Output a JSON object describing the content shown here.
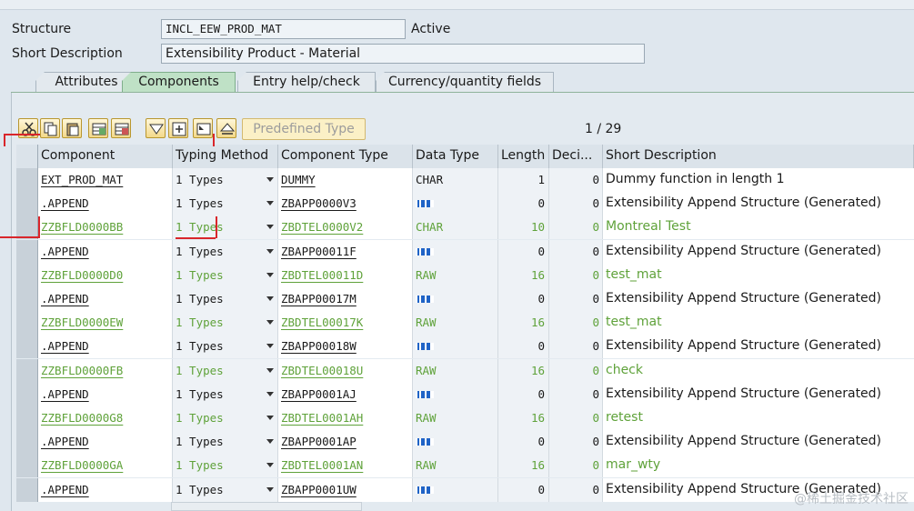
{
  "header": {
    "structure_label": "Structure",
    "structure_value": "INCL_EEW_PROD_MAT",
    "status": "Active",
    "short_desc_label": "Short Description",
    "short_desc_value": "Extensibility Product - Material"
  },
  "tabs": [
    {
      "label": "Attributes",
      "active": false
    },
    {
      "label": "Components",
      "active": true
    },
    {
      "label": "Entry help/check",
      "active": false
    },
    {
      "label": "Currency/quantity fields",
      "active": false
    }
  ],
  "toolbar": {
    "icons": [
      "cut-icon",
      "copy-icon",
      "paste-icon",
      "insert-row-icon",
      "delete-row-icon",
      "filter-icon",
      "details-icon",
      "settings-icon",
      "collapse-icon"
    ],
    "predefined_type_label": "Predefined Type",
    "pager": "1  / 29"
  },
  "columns": {
    "component": "Component",
    "typing_method": "Typing Method",
    "component_type": "Component Type",
    "data_type": "Data Type",
    "length": "Length",
    "decimals": "Deci...",
    "short_description": "Short Description"
  },
  "rows": [
    {
      "component": "EXT_PROD_MAT",
      "typing": "1 Types",
      "ctype": "DUMMY",
      "dtype": "CHAR",
      "length": "1",
      "dec": "0",
      "desc": "Dummy function in length 1",
      "green": false,
      "struct": false
    },
    {
      "component": ".APPEND",
      "typing": "1 Types",
      "ctype": "ZBAPP0000V3",
      "dtype": "",
      "length": "0",
      "dec": "0",
      "desc": "Extensibility Append Structure (Generated)",
      "green": false,
      "struct": true
    },
    {
      "component": "ZZBFLD0000BB",
      "typing": "1 Types",
      "ctype": "ZBDTEL0000V2",
      "dtype": "CHAR",
      "length": "10",
      "dec": "0",
      "desc": "Montreal Test",
      "green": true,
      "struct": false
    },
    {
      "component": ".APPEND",
      "typing": "1 Types",
      "ctype": "ZBAPP00011F",
      "dtype": "",
      "length": "0",
      "dec": "0",
      "desc": "Extensibility Append Structure (Generated)",
      "green": false,
      "struct": true
    },
    {
      "component": "ZZBFLD0000D0",
      "typing": "1 Types",
      "ctype": "ZBDTEL00011D",
      "dtype": "RAW",
      "length": "16",
      "dec": "0",
      "desc": "test_mat",
      "green": true,
      "struct": false
    },
    {
      "component": ".APPEND",
      "typing": "1 Types",
      "ctype": "ZBAPP00017M",
      "dtype": "",
      "length": "0",
      "dec": "0",
      "desc": "Extensibility Append Structure (Generated)",
      "green": false,
      "struct": true
    },
    {
      "component": "ZZBFLD0000EW",
      "typing": "1 Types",
      "ctype": "ZBDTEL00017K",
      "dtype": "RAW",
      "length": "16",
      "dec": "0",
      "desc": "test_mat",
      "green": true,
      "struct": false
    },
    {
      "component": ".APPEND",
      "typing": "1 Types",
      "ctype": "ZBAPP00018W",
      "dtype": "",
      "length": "0",
      "dec": "0",
      "desc": "Extensibility Append Structure (Generated)",
      "green": false,
      "struct": true
    },
    {
      "component": "ZZBFLD0000FB",
      "typing": "1 Types",
      "ctype": "ZBDTEL00018U",
      "dtype": "RAW",
      "length": "16",
      "dec": "0",
      "desc": "check",
      "green": true,
      "struct": false
    },
    {
      "component": ".APPEND",
      "typing": "1 Types",
      "ctype": "ZBAPP0001AJ",
      "dtype": "",
      "length": "0",
      "dec": "0",
      "desc": "Extensibility Append Structure (Generated)",
      "green": false,
      "struct": true
    },
    {
      "component": "ZZBFLD0000G8",
      "typing": "1 Types",
      "ctype": "ZBDTEL0001AH",
      "dtype": "RAW",
      "length": "16",
      "dec": "0",
      "desc": "retest",
      "green": true,
      "struct": false
    },
    {
      "component": ".APPEND",
      "typing": "1 Types",
      "ctype": "ZBAPP0001AP",
      "dtype": "",
      "length": "0",
      "dec": "0",
      "desc": "Extensibility Append Structure (Generated)",
      "green": false,
      "struct": true
    },
    {
      "component": "ZZBFLD0000GA",
      "typing": "1 Types",
      "ctype": "ZBDTEL0001AN",
      "dtype": "RAW",
      "length": "16",
      "dec": "0",
      "desc": "mar_wty",
      "green": true,
      "struct": false
    },
    {
      "component": ".APPEND",
      "typing": "1 Types",
      "ctype": "ZBAPP0001UW",
      "dtype": "",
      "length": "0",
      "dec": "0",
      "desc": "Extensibility Append Structure (Generated)",
      "green": false,
      "struct": true
    }
  ],
  "watermark": "@稀土掘金技术社区",
  "colors": {
    "green_text": "#5fa23a",
    "active_tab": "#bfe1c6",
    "toolbar_button": "#f3d98a"
  }
}
